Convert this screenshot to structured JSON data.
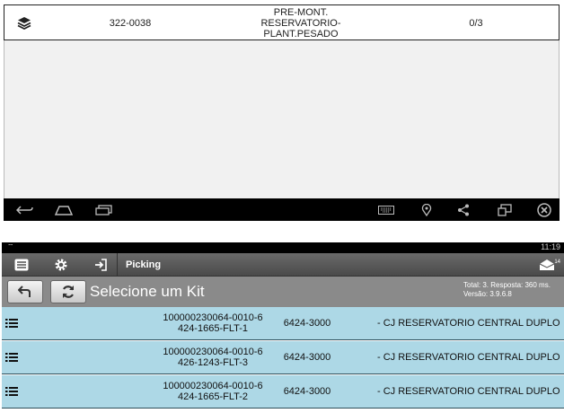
{
  "top_panel": {
    "row": {
      "code": "322-0038",
      "description": "PRE-MONT. RESERVATORIO-PLANT.PESADO",
      "progress": "0/3"
    }
  },
  "bottom_panel": {
    "status_bar": {
      "time": "11:19"
    },
    "toolbar": {
      "title": "Picking",
      "mail_badge": "14"
    },
    "header": {
      "title": "Selecione um Kit",
      "summary": "Total: 3. Resposta: 360 ms.",
      "version": "Versão: 3.9.6.8"
    },
    "kits": [
      {
        "code": "100000230064-0010-6\n424-1665-FLT-1",
        "number": "6424-3000",
        "description": "- CJ RESERVATORIO CENTRAL DUPLO"
      },
      {
        "code": "100000230064-0010-6\n426-1243-FLT-3",
        "number": "6424-3000",
        "description": "- CJ RESERVATORIO CENTRAL DUPLO"
      },
      {
        "code": "100000230064-0010-6\n424-1665-FLT-2",
        "number": "6424-3000",
        "description": "- CJ RESERVATORIO CENTRAL DUPLO"
      }
    ]
  },
  "colors": {
    "row_bg": "#add8e6",
    "toolbar_bg": "#5a5a5a",
    "navbar_bg": "#000000"
  },
  "icons": [
    "layers-icon",
    "back-icon",
    "home-icon",
    "recent-apps-icon",
    "keyboard-icon",
    "location-icon",
    "share-icon",
    "screenshot-icon",
    "close-circle-icon",
    "menu-icon",
    "gear-icon",
    "login-icon",
    "mail-icon",
    "undo-icon",
    "refresh-icon",
    "list-icon"
  ]
}
